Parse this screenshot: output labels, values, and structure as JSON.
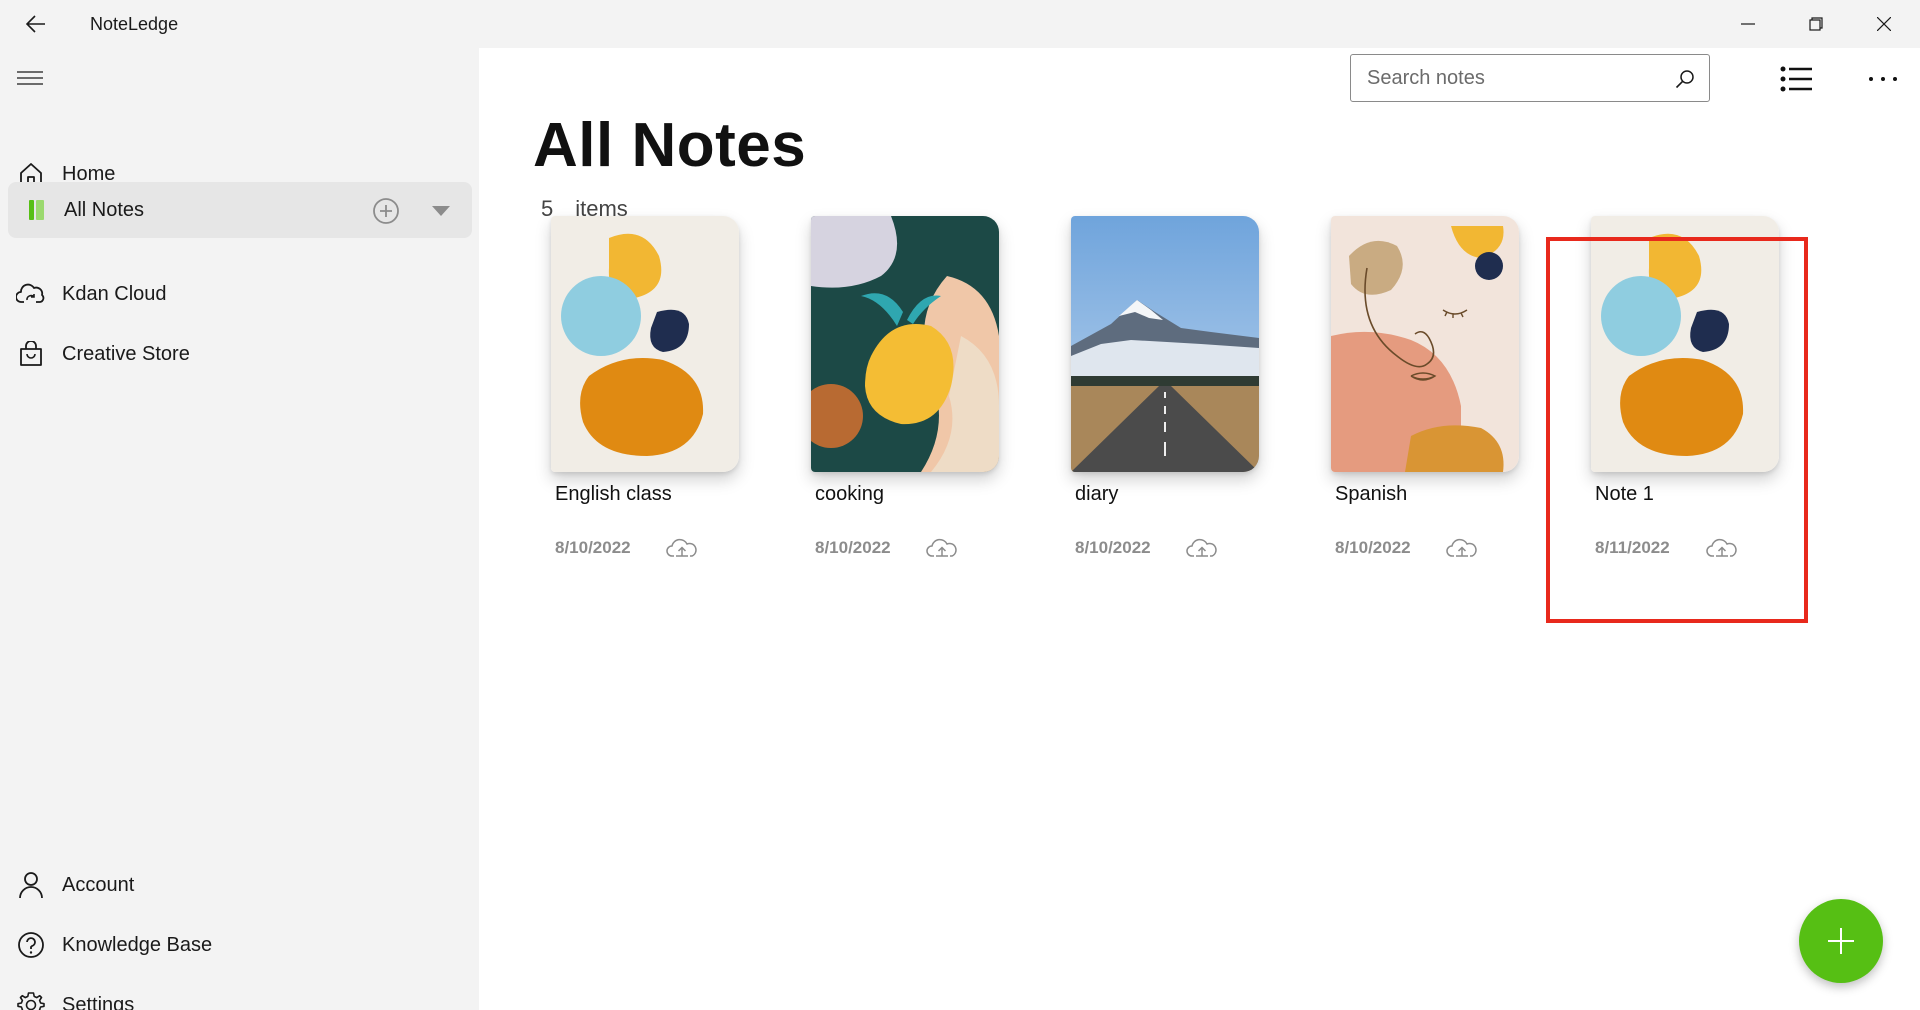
{
  "window": {
    "title": "NoteLedge",
    "controls": {
      "minimize": "minimize-icon",
      "restore": "restore-icon",
      "close": "close-icon"
    }
  },
  "sidebar": {
    "menu_icon": "hamburger-icon",
    "items": [
      {
        "label": "Home",
        "icon": "home-icon"
      },
      {
        "label": "All Notes",
        "icon": "notebook-icon",
        "active": true
      },
      {
        "label": "Kdan Cloud",
        "icon": "cloud-sync-icon"
      },
      {
        "label": "Creative Store",
        "icon": "shopping-bag-icon"
      }
    ],
    "bottom_items": [
      {
        "label": "Account",
        "icon": "person-icon"
      },
      {
        "label": "Knowledge Base",
        "icon": "help-icon"
      },
      {
        "label": "Settings",
        "icon": "gear-icon"
      }
    ],
    "accent_color": "#56bf14"
  },
  "toolbar": {
    "search_placeholder": "Search notes",
    "search_value": "",
    "view_icon": "list-view-icon",
    "more_icon": "more-icon"
  },
  "main": {
    "title": "All Notes",
    "count": "5",
    "count_label": "items",
    "notes": [
      {
        "title": "English class",
        "date": "8/10/2022",
        "cover": "abstract-shapes"
      },
      {
        "title": "cooking",
        "date": "8/10/2022",
        "cover": "lemon"
      },
      {
        "title": "diary",
        "date": "8/10/2022",
        "cover": "mountain-road"
      },
      {
        "title": "Spanish",
        "date": "8/10/2022",
        "cover": "line-face"
      },
      {
        "title": "Note 1",
        "date": "8/11/2022",
        "cover": "abstract-shapes",
        "highlighted": true
      }
    ],
    "highlight_color": "#e8291c"
  },
  "fab": {
    "icon": "plus-icon",
    "color": "#56bf14"
  }
}
